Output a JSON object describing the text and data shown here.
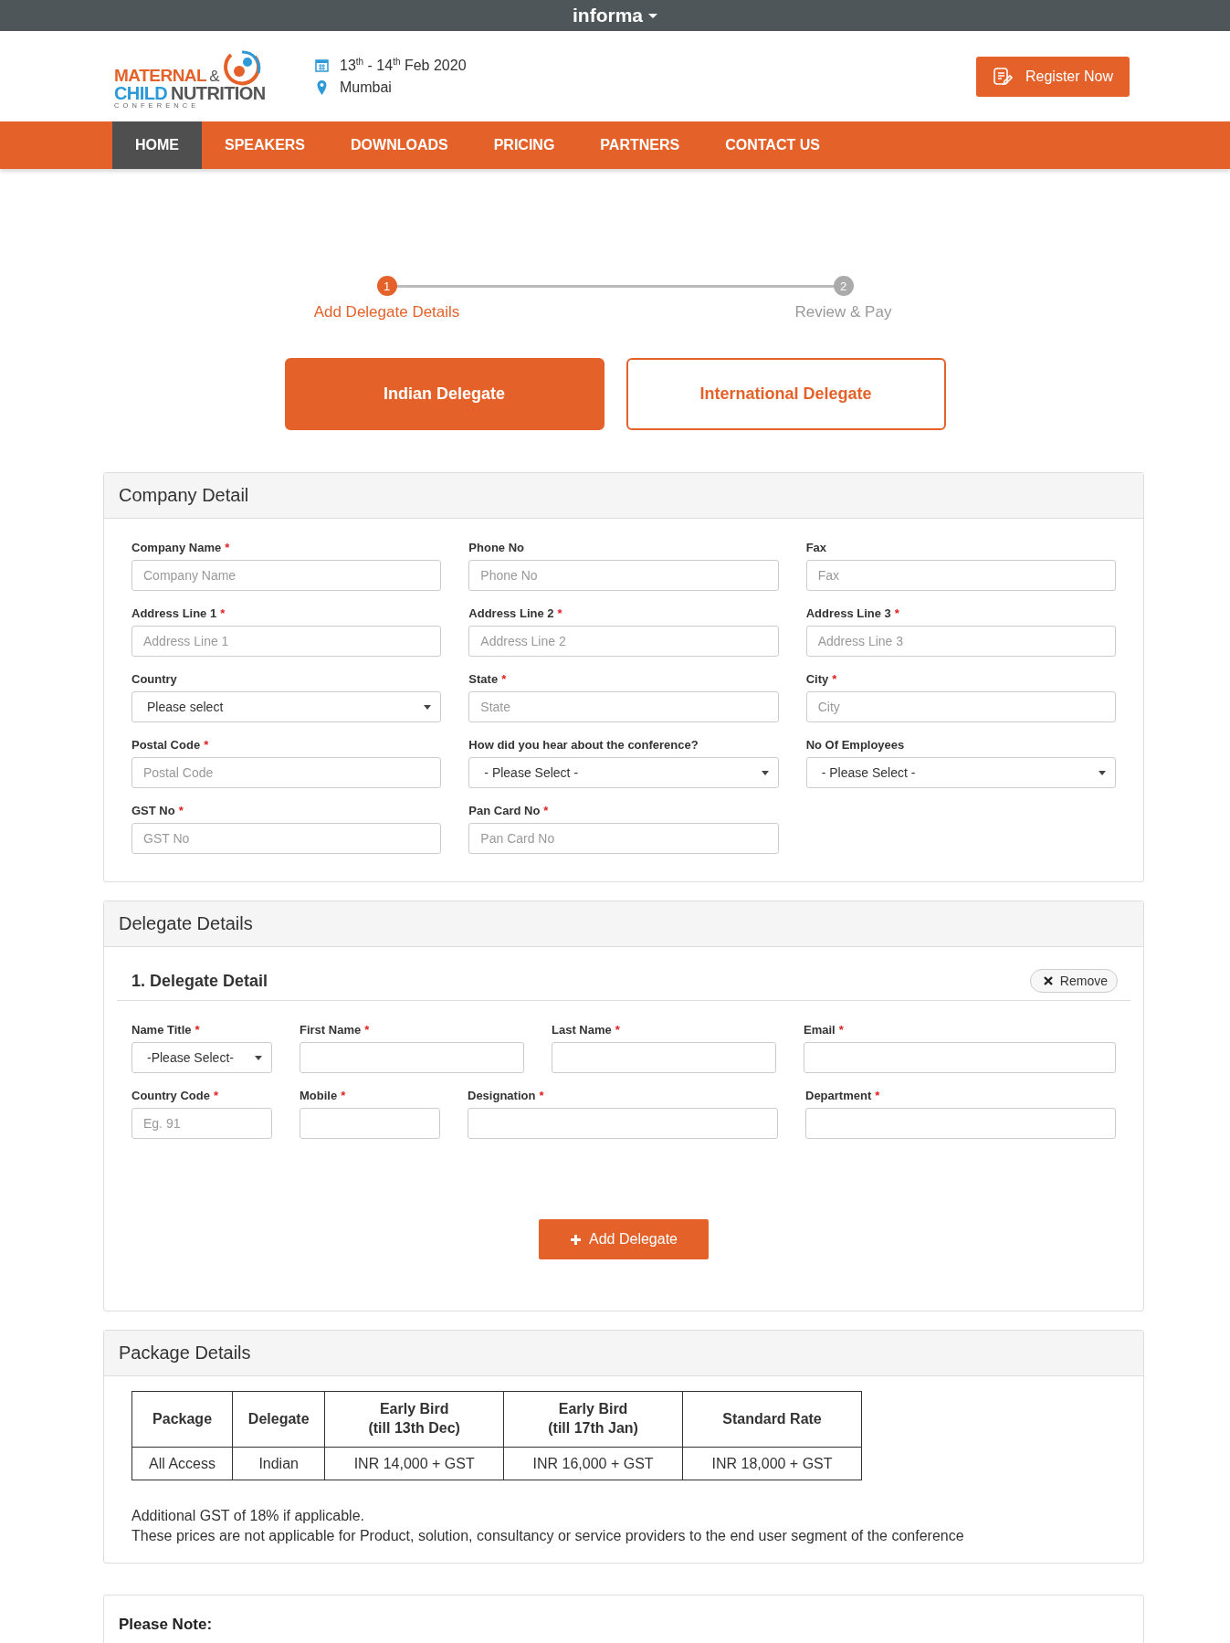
{
  "top_bar": {
    "brand": "informa"
  },
  "header": {
    "logo": {
      "word_1": "MATERNAL",
      "amp": "&",
      "word_2": "CHILD",
      "word_3": "NUTRITION",
      "tagline": "C O N F E R E N C E"
    },
    "date": "13$^{th}$ - 14$^{th}$ Feb 2020",
    "location": "Mumbai",
    "register_button": "Register Now"
  },
  "nav": [
    {
      "label": "HOME",
      "selected": true
    },
    {
      "label": "SPEAKERS",
      "selected": false
    },
    {
      "label": "DOWNLOADS",
      "selected": false
    },
    {
      "label": "PRICING",
      "selected": false
    },
    {
      "label": "PARTNERS",
      "selected": false
    },
    {
      "label": "CONTACT US",
      "selected": false
    }
  ],
  "stepper": [
    {
      "number": "1",
      "label": "Add Delegate Details",
      "selected": true
    },
    {
      "number": "2",
      "label": "Review & Pay",
      "selected": false
    }
  ],
  "delegate_types": [
    {
      "label": "Indian Delegate",
      "selected": true
    },
    {
      "label": "International Delegate",
      "selected": false
    }
  ],
  "required_marker": "*",
  "company_detail": {
    "title": "Company Detail",
    "fields": [
      {
        "label": "Company Name",
        "required": true,
        "kind": "text",
        "placeholder": "Company Name"
      },
      {
        "label": "Phone No",
        "required": false,
        "kind": "text",
        "placeholder": "Phone No"
      },
      {
        "label": "Fax",
        "required": false,
        "kind": "text",
        "placeholder": "Fax"
      },
      {
        "label": "Address Line 1",
        "required": true,
        "kind": "text",
        "placeholder": "Address Line 1"
      },
      {
        "label": "Address Line 2",
        "required": true,
        "kind": "text",
        "placeholder": "Address Line 2"
      },
      {
        "label": "Address Line 3",
        "required": true,
        "kind": "text",
        "placeholder": "Address Line 3"
      },
      {
        "label": "Country",
        "required": false,
        "kind": "select",
        "value": "Please select"
      },
      {
        "label": "State",
        "required": true,
        "kind": "text",
        "placeholder": "State"
      },
      {
        "label": "City",
        "required": true,
        "kind": "text",
        "placeholder": "City"
      },
      {
        "label": "Postal Code",
        "required": true,
        "kind": "text",
        "placeholder": "Postal Code"
      },
      {
        "label": "How did you hear about the conference?",
        "required": false,
        "kind": "select",
        "value": "- Please Select -"
      },
      {
        "label": "No Of Employees",
        "required": false,
        "kind": "select",
        "value": "- Please Select -"
      },
      {
        "label": "GST No",
        "required": true,
        "kind": "text",
        "placeholder": "GST No"
      },
      {
        "label": "Pan Card No",
        "required": true,
        "kind": "text",
        "placeholder": "Pan Card No"
      }
    ]
  },
  "delegate_details": {
    "title": "Delegate Details",
    "delegates": [
      {
        "number": "1.",
        "title": "Delegate Detail",
        "remove_button": "Remove",
        "rows": [
          [
            {
              "label": "Name Title",
              "required": true,
              "kind": "select",
              "value": "-Please Select-"
            },
            {
              "label": "First Name",
              "required": true,
              "kind": "text"
            },
            {
              "label": "Last Name",
              "required": true,
              "kind": "text"
            },
            {
              "label": "Email",
              "required": true,
              "kind": "text"
            }
          ],
          [
            {
              "label": "Country Code",
              "required": true,
              "kind": "text",
              "placeholder": "Eg. 91"
            },
            {
              "label": "Mobile",
              "required": true,
              "kind": "text"
            },
            {
              "label": "Designation",
              "required": true,
              "kind": "text"
            },
            {
              "label": "Department",
              "required": true,
              "kind": "text"
            }
          ]
        ]
      }
    ],
    "add_button": "Add Delegate"
  },
  "package_details": {
    "title": "Package Details",
    "table": {
      "columns": [
        "Package",
        "Delegate",
        "Early Bird\n(till 13th Dec)",
        "Early Bird\n(till 17th Jan)",
        "Standard Rate"
      ],
      "rows": [
        [
          "All Access",
          "Indian",
          "INR 14,000 + GST",
          "INR 16,000 + GST",
          "INR 18,000 + GST"
        ]
      ]
    },
    "notes": [
      "Additional GST of 18% if applicable.",
      "These prices are not applicable for Product, solution, consultancy or service providers to the end user segment of the conference"
    ]
  },
  "please_note": {
    "title": "Please Note:"
  }
}
